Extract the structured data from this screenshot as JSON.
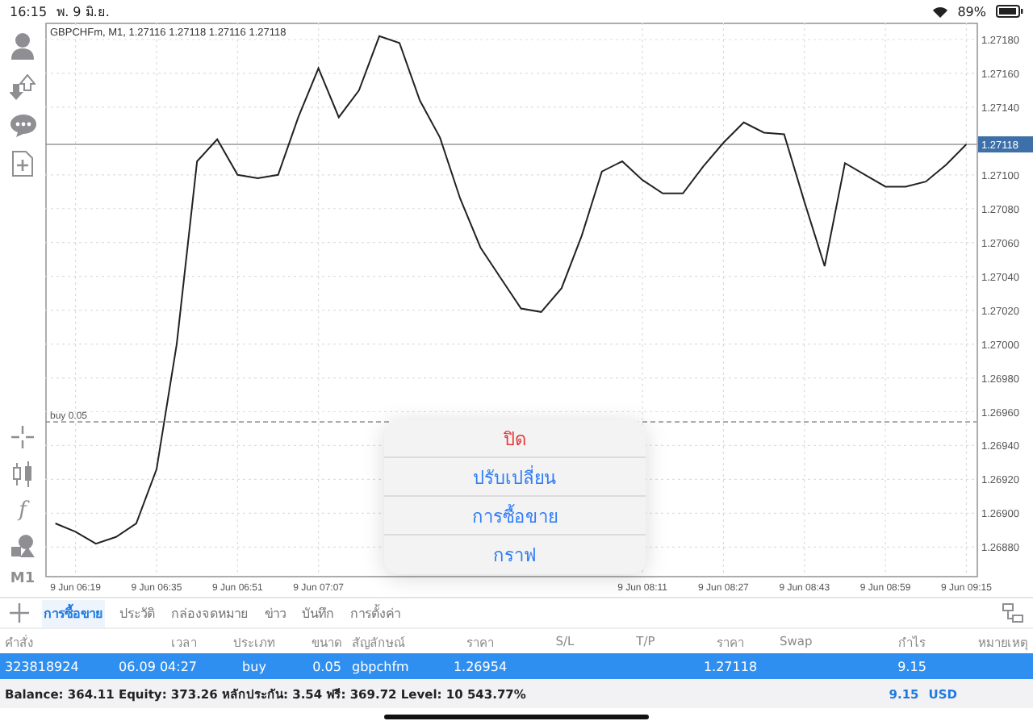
{
  "status_bar": {
    "time": "16:15",
    "date": "พ. 9 มิ.ย.",
    "battery": "89%"
  },
  "toolbar": {
    "indicators_glyph": "f",
    "timeframe": "M1"
  },
  "chart": {
    "title": "GBPCHFm, M1, 1.27116 1.27118 1.27116 1.27118",
    "chart_data": {
      "type": "line",
      "categories": [
        null,
        "9 Jun 06:19",
        null,
        null,
        null,
        "9 Jun 06:35",
        null,
        null,
        null,
        "9 Jun 06:51",
        null,
        null,
        null,
        "9 Jun 07:07",
        null,
        null,
        null,
        null,
        null,
        null,
        null,
        null,
        null,
        null,
        null,
        null,
        null,
        null,
        null,
        "9 Jun 08:11",
        null,
        null,
        null,
        "9 Jun 08:27",
        null,
        null,
        null,
        "9 Jun 08:43",
        null,
        null,
        null,
        "9 Jun 08:59",
        null,
        null,
        null,
        "9 Jun 09:15"
      ],
      "series": [
        {
          "color": "#222222",
          "values": [
            1.26894,
            1.26889,
            1.26882,
            1.26886,
            1.26894,
            1.26926,
            1.27,
            1.27108,
            1.27121,
            1.271,
            1.27098,
            1.271,
            1.27134,
            1.27163,
            1.27134,
            1.2715,
            1.27182,
            1.27178,
            1.27144,
            1.27122,
            1.27086,
            1.27057,
            1.27039,
            1.27021,
            1.27019,
            1.27033,
            1.27064,
            1.27102,
            1.27108,
            1.27097,
            1.27089,
            1.27089,
            1.27105,
            1.27119,
            1.27131,
            1.27125,
            1.27124,
            1.27084,
            1.27046,
            1.27107,
            1.271,
            1.27093,
            1.27093,
            1.27096,
            1.27106,
            1.27118
          ]
        }
      ],
      "ylim": [
        1.26863,
        1.2719
      ],
      "yticks": [
        {
          "value": 1.2718,
          "label": "1.27180"
        },
        {
          "value": 1.2716,
          "label": "1.27160"
        },
        {
          "value": 1.2714,
          "label": "1.27140"
        },
        {
          "value": 1.271,
          "label": "1.27100"
        },
        {
          "value": 1.2708,
          "label": "1.27080"
        },
        {
          "value": 1.2706,
          "label": "1.27060"
        },
        {
          "value": 1.2704,
          "label": "1.27040"
        },
        {
          "value": 1.2702,
          "label": "1.27020"
        },
        {
          "value": 1.27,
          "label": "1.27000"
        },
        {
          "value": 1.2698,
          "label": "1.26980"
        },
        {
          "value": 1.2696,
          "label": "1.26960"
        },
        {
          "value": 1.2694,
          "label": "1.26940"
        },
        {
          "value": 1.2692,
          "label": "1.26920"
        },
        {
          "value": 1.269,
          "label": "1.26900"
        },
        {
          "value": 1.2688,
          "label": "1.26880"
        }
      ],
      "grid": true,
      "ref_lines": [
        {
          "axis": "y",
          "value": 1.27118,
          "label": "1.27118",
          "color": "#999999"
        },
        {
          "axis": "y",
          "value": 1.26954,
          "label": "buy 0.05",
          "color": "#999999"
        }
      ]
    }
  },
  "context_menu": [
    {
      "label": "ปิด",
      "kind": "destructive"
    },
    {
      "label": "ปรับเปลี่ยน",
      "kind": "action"
    },
    {
      "label": "การซื้อขาย",
      "kind": "action"
    },
    {
      "label": "กราฟ",
      "kind": "action"
    }
  ],
  "tabs": [
    {
      "label": "การซื้อขาย",
      "selected": true
    },
    {
      "label": "ประวัติ",
      "selected": false
    },
    {
      "label": "กล่องจดหมาย",
      "selected": false
    },
    {
      "label": "ข่าว",
      "selected": false
    },
    {
      "label": "บันทึก",
      "selected": false
    },
    {
      "label": "การตั้งค่า",
      "selected": false
    }
  ],
  "table": {
    "columns": [
      "คำสั่ง",
      "เวลา",
      "ประเภท",
      "ขนาด",
      "สัญลักษณ์",
      "ราคา",
      "S/L",
      "T/P",
      "ราคา",
      "Swap",
      "กำไร",
      "หมายเหตุ"
    ],
    "rows": [
      {
        "selected": true,
        "cells": [
          "323818924",
          "06.09 04:27",
          "buy",
          "0.05",
          "gbpchfm",
          "1.26954",
          null,
          null,
          "1.27118",
          null,
          "9.15",
          null
        ]
      }
    ]
  },
  "summary": {
    "text": "Balance: 364.11 Equity: 373.26 หลักประกัน: 3.54 ฟรี: 369.72 Level: 10 543.77%",
    "profit": "9.15",
    "currency": "USD"
  }
}
